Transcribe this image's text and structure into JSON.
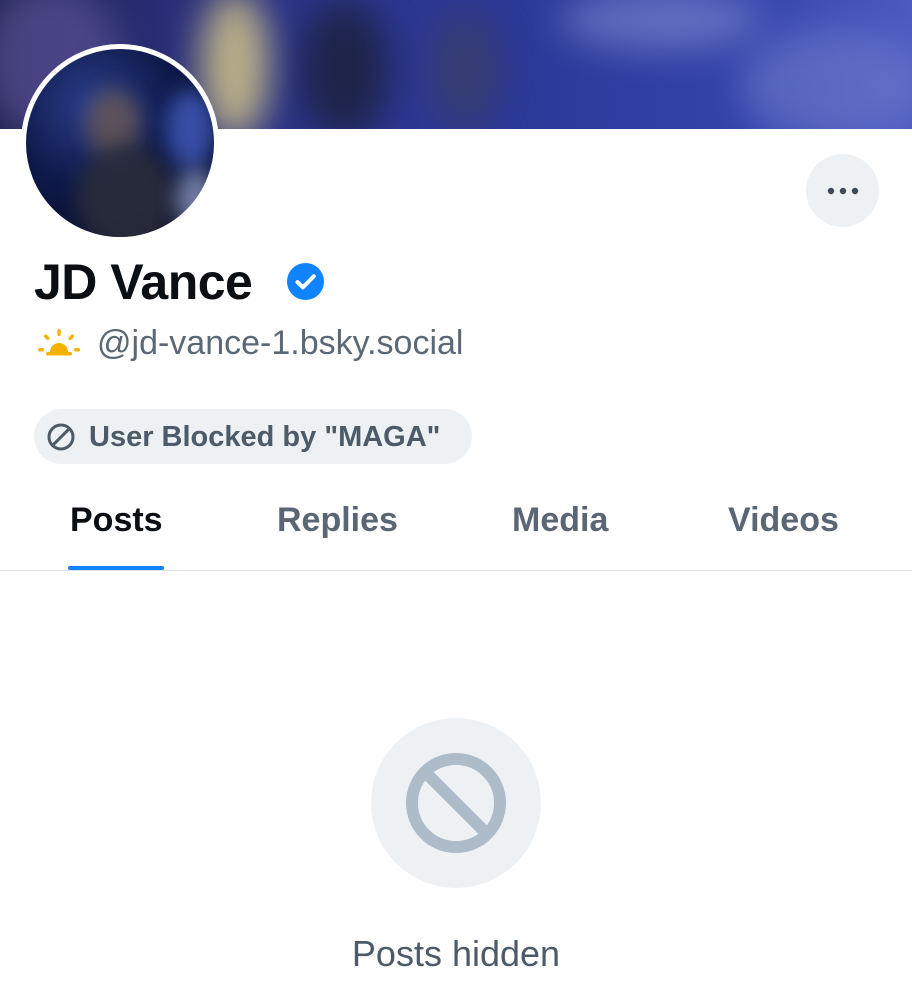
{
  "banner": {
    "description_icon": "banner-image"
  },
  "profile": {
    "display_name": "JD Vance",
    "verified": true,
    "handle": "@jd-vance-1.bsky.social",
    "handle_icon": "sunrise-icon"
  },
  "more_button": {
    "icon": "more-horizontal-icon"
  },
  "badge": {
    "icon": "ban-icon",
    "label": "User Blocked by \"MAGA\""
  },
  "tabs": [
    {
      "label": "Posts",
      "active": true
    },
    {
      "label": "Replies",
      "active": false
    },
    {
      "label": "Media",
      "active": false
    },
    {
      "label": "Videos",
      "active": false
    }
  ],
  "empty_state": {
    "icon": "ban-icon",
    "text": "Posts hidden"
  },
  "colors": {
    "accent": "#1083fe",
    "verified": "#1083fe",
    "sun": "#f5b301",
    "muted_text": "#5b6876",
    "empty_icon": "#aebbc8"
  }
}
